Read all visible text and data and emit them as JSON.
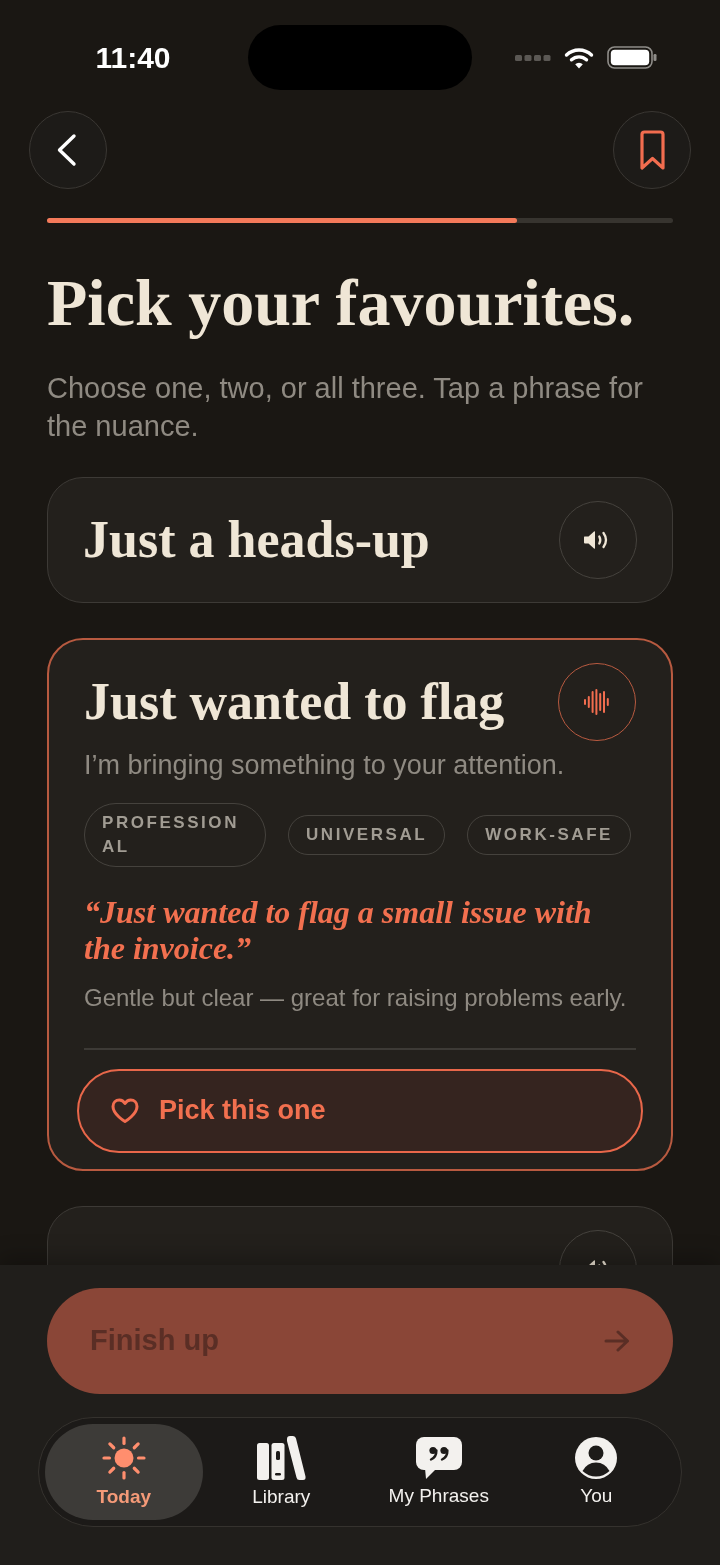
{
  "status_bar": {
    "time": "11:40"
  },
  "header": {
    "progress": {
      "level": 0.75
    }
  },
  "heading": {
    "title": "Pick your favourites.",
    "subtitle": "Choose one, two, or all three. Tap a phrase for the nuance."
  },
  "cards": [
    {
      "title": "Just a heads-up",
      "expanded": false,
      "playing": false
    },
    {
      "title": "Just wanted to flag",
      "expanded": true,
      "playing": true,
      "meaning": "I’m bringing something to your attention.",
      "tags": [
        "PROFESSIONAL",
        "UNIVERSAL",
        "WORK-SAFE"
      ],
      "example": "“Just wanted to flag a small issue with the invoice.”",
      "note": "Gentle but clear — great for raising problems early.",
      "pick_button": {
        "label": "Pick this one",
        "picked": false
      }
    },
    {
      "expanded": false,
      "playing": false
    }
  ],
  "finish_button": {
    "label": "Finish up",
    "disabled": true
  },
  "tab_bar": [
    {
      "label": "Today",
      "selected": true
    },
    {
      "label": "Library",
      "selected": false
    },
    {
      "label": "My Phrases",
      "selected": false
    },
    {
      "label": "You",
      "selected": false
    }
  ]
}
